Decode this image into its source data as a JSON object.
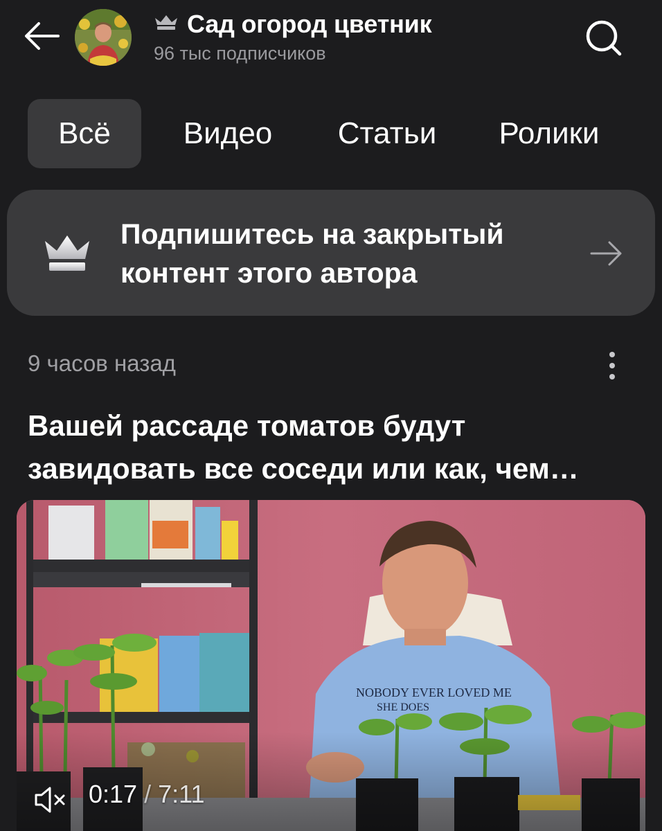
{
  "header": {
    "channel_title": "Сад огород цветник",
    "subscribers": "96 тыс подписчиков"
  },
  "tabs": [
    {
      "label": "Всё",
      "active": true
    },
    {
      "label": "Видео",
      "active": false
    },
    {
      "label": "Статьи",
      "active": false
    },
    {
      "label": "Ролики",
      "active": false
    }
  ],
  "banner": {
    "line1": "Подпишитесь на закрытый",
    "line2": "контент этого автора"
  },
  "post": {
    "time_ago": "9 часов назад",
    "title_line1": "Вашей рассаде томатов будут",
    "title_line2": "завидовать все соседи или как, чем…",
    "video": {
      "current_time": "0:17",
      "separator": "/",
      "duration": "7:11",
      "muted": true
    }
  },
  "icons": {
    "back": "arrow-left-icon",
    "search": "search-icon",
    "crown": "crown-icon",
    "arrow": "arrow-right-icon",
    "more": "more-vertical-icon",
    "mute": "speaker-muted-icon"
  },
  "colors": {
    "background": "#1c1c1e",
    "surface": "#3a3a3c",
    "secondary_text": "#9a9a9e"
  }
}
